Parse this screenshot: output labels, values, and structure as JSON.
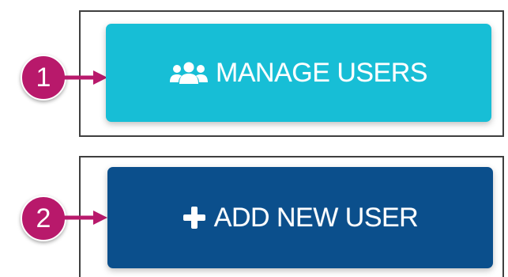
{
  "colors": {
    "manage_button_bg": "#17bed6",
    "add_button_bg": "#0b4f8c",
    "marker_bg": "#b8196b",
    "arrow": "#b8196b",
    "frame_border": "#3f3f3f"
  },
  "steps": [
    {
      "number": "1",
      "button_label": "MANAGE USERS",
      "icon": "users-group-icon"
    },
    {
      "number": "2",
      "button_label": "ADD NEW USER",
      "icon": "plus-icon"
    }
  ]
}
